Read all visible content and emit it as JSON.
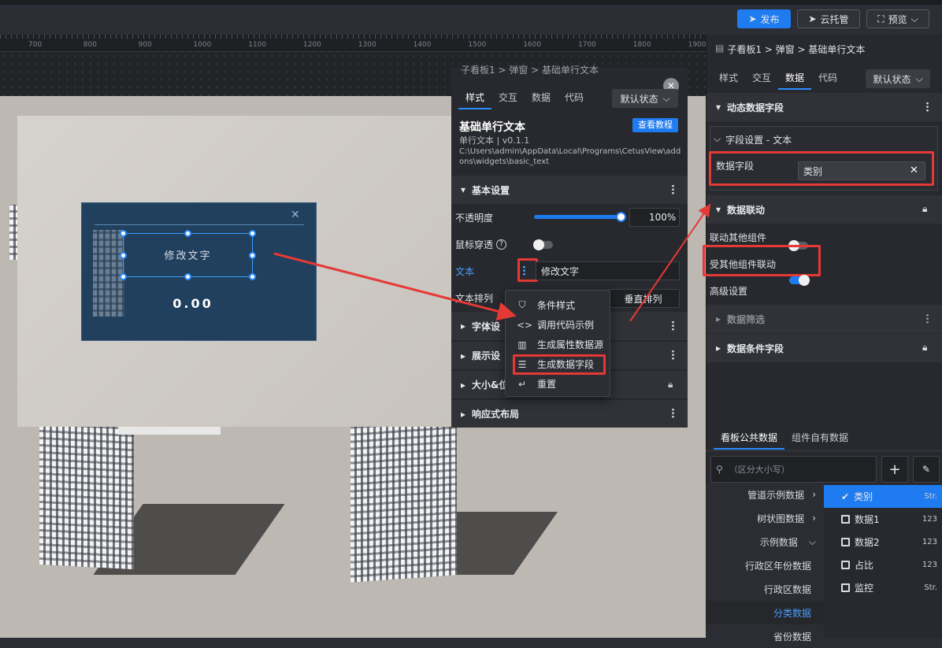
{
  "topbar": {
    "publish": "发布",
    "cloud": "云托管",
    "preview": "预览"
  },
  "ruler": {
    "ticks": [
      "700",
      "800",
      "900",
      "1000",
      "1100",
      "1200",
      "1300",
      "1400",
      "1500",
      "1600",
      "1700",
      "1800",
      "1900"
    ]
  },
  "canvas": {
    "dialog_text": "修改文字",
    "dialog_value": "0.00",
    "dialog_close": "✕"
  },
  "overlay_panel": {
    "breadcrumb": "子看板1 > 弹窗 > 基础单行文本",
    "tabs": [
      "样式",
      "交互",
      "数据",
      "代码"
    ],
    "state_select": "默认状态",
    "widget_title": "基础单行文本",
    "tutorial_btn": "查看教程",
    "version": "单行文本 | v0.1.1",
    "path": "C:\\Users\\admin\\AppData\\Local\\Programs\\CetusView\\addons\\widgets\\basic_text",
    "basic_settings": "基本设置",
    "opacity_label": "不透明度",
    "opacity_value": "100",
    "opacity_unit": "%",
    "mouse_through": "鼠标穿透",
    "help": "?",
    "text_label": "文本",
    "text_value": "修改文字",
    "text_arrange": "文本排列",
    "vertical": "垂直排列",
    "font_settings": "字体设",
    "display_settings": "展示设",
    "size_pos": "大小&位",
    "responsive": "响应式布局"
  },
  "context_menu": {
    "items": [
      {
        "icon": "filter-icon",
        "glyph": "⛉",
        "label": "条件样式"
      },
      {
        "icon": "code-icon",
        "glyph": "<>",
        "label": "调用代码示例"
      },
      {
        "icon": "chart-icon",
        "glyph": "▥",
        "label": "生成属性数据源"
      },
      {
        "icon": "database-icon",
        "glyph": "☰",
        "label": "生成数据字段"
      },
      {
        "icon": "reset-icon",
        "glyph": "↵",
        "label": "重置"
      }
    ]
  },
  "right_panel": {
    "breadcrumb": "子看板1 > 弹窗 > 基础单行文本",
    "tabs": [
      "样式",
      "交互",
      "数据",
      "代码"
    ],
    "state_select": "默认状态",
    "dyn_fields": "动态数据字段",
    "field_setting": "字段设置 - 文本",
    "data_field_label": "数据字段",
    "data_field_value": "类别",
    "linkage": "数据联动",
    "link_others": "联动其他组件",
    "linked_by_others": "受其他组件联动",
    "advanced": "高级设置",
    "data_filter": "数据筛选",
    "condition_fields": "数据条件字段",
    "data_tabs": [
      "看板公共数据",
      "组件自有数据"
    ],
    "search_placeholder": "（区分大小写）",
    "left_items": [
      "管道示例数据",
      "树状图数据",
      "示例数据",
      "行政区年份数据",
      "行政区数据",
      "分类数据",
      "省份数据"
    ],
    "right_items": [
      {
        "label": "类别",
        "type": "Str.",
        "checked": true
      },
      {
        "label": "数据1",
        "type": "123",
        "checked": false
      },
      {
        "label": "数据2",
        "type": "123",
        "checked": false
      },
      {
        "label": "占比",
        "type": "123",
        "checked": false
      },
      {
        "label": "监控",
        "type": "Str.",
        "checked": false
      }
    ]
  },
  "colors": {
    "accent": "#1f7cf0",
    "highlight": "#e53935",
    "panel": "#27292e"
  }
}
